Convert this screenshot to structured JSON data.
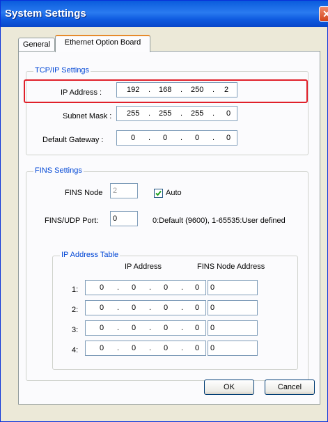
{
  "window": {
    "title": "System Settings",
    "close_glyph": "✕"
  },
  "tabs": [
    {
      "label": "General"
    },
    {
      "label": "Ethernet Option Board"
    }
  ],
  "tcpip": {
    "group_label": "TCP/IP Settings",
    "ip_label": "IP Address :",
    "ip": [
      "192",
      "168",
      "250",
      "2"
    ],
    "mask_label": "Subnet Mask :",
    "mask": [
      "255",
      "255",
      "255",
      "0"
    ],
    "gw_label": "Default Gateway :",
    "gw": [
      "0",
      "0",
      "0",
      "0"
    ]
  },
  "fins": {
    "group_label": "FINS Settings",
    "node_label": "FINS Node",
    "node_value": "2",
    "auto_label": "Auto",
    "auto_checked": true,
    "port_label": "FINS/UDP Port:",
    "port_value": "0",
    "port_hint": "0:Default (9600), 1-65535:User defined"
  },
  "table": {
    "group_label": "IP Address Table",
    "col_ip": "IP Address",
    "col_node": "FINS Node Address",
    "rows": [
      {
        "index": "1:",
        "ip": [
          "0",
          "0",
          "0",
          "0"
        ],
        "node": "0"
      },
      {
        "index": "2:",
        "ip": [
          "0",
          "0",
          "0",
          "0"
        ],
        "node": "0"
      },
      {
        "index": "3:",
        "ip": [
          "0",
          "0",
          "0",
          "0"
        ],
        "node": "0"
      },
      {
        "index": "4:",
        "ip": [
          "0",
          "0",
          "0",
          "0"
        ],
        "node": "0"
      }
    ]
  },
  "buttons": {
    "ok": "OK",
    "cancel": "Cancel"
  },
  "highlight_color": "#e0202a",
  "dot": "."
}
